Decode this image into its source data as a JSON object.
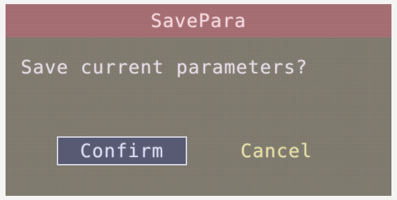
{
  "dialog": {
    "title": "SavePara",
    "message": "Save current parameters?",
    "buttons": {
      "confirm_label": "Confirm",
      "cancel_label": "Cancel"
    }
  },
  "colors": {
    "titlebar": "#a66d72",
    "dialog_background": "#7f7a6e",
    "confirm_button_background": "#575a72",
    "cancel_text": "#e7e0a6"
  }
}
